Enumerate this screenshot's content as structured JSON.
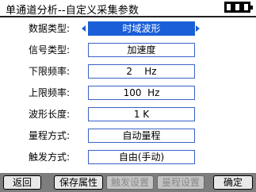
{
  "header": {
    "title": "单通道分析--自定义采集参数",
    "battery_icon": "battery-icon"
  },
  "colors": {
    "accent": "#1a5fd8",
    "field_border": "#3a62c8",
    "toolbar_bg": "#7d7d7d"
  },
  "params": [
    {
      "label": "数据类型:",
      "value": "时域波形",
      "selected": true
    },
    {
      "label": "信号类型:",
      "value": "加速度"
    },
    {
      "label": "下限频率:",
      "value": "2    Hz"
    },
    {
      "label": "上限频率:",
      "value": "100  Hz"
    },
    {
      "label": "波形长度:",
      "value": "1 K"
    },
    {
      "label": "量程方式:",
      "value": "自动量程"
    },
    {
      "label": "触发方式:",
      "value": "自由(手动)"
    }
  ],
  "toolbar": {
    "back": "返回",
    "save": "保存属性",
    "trigger": "触发设置",
    "range": "量程设置",
    "ok": "确定"
  }
}
